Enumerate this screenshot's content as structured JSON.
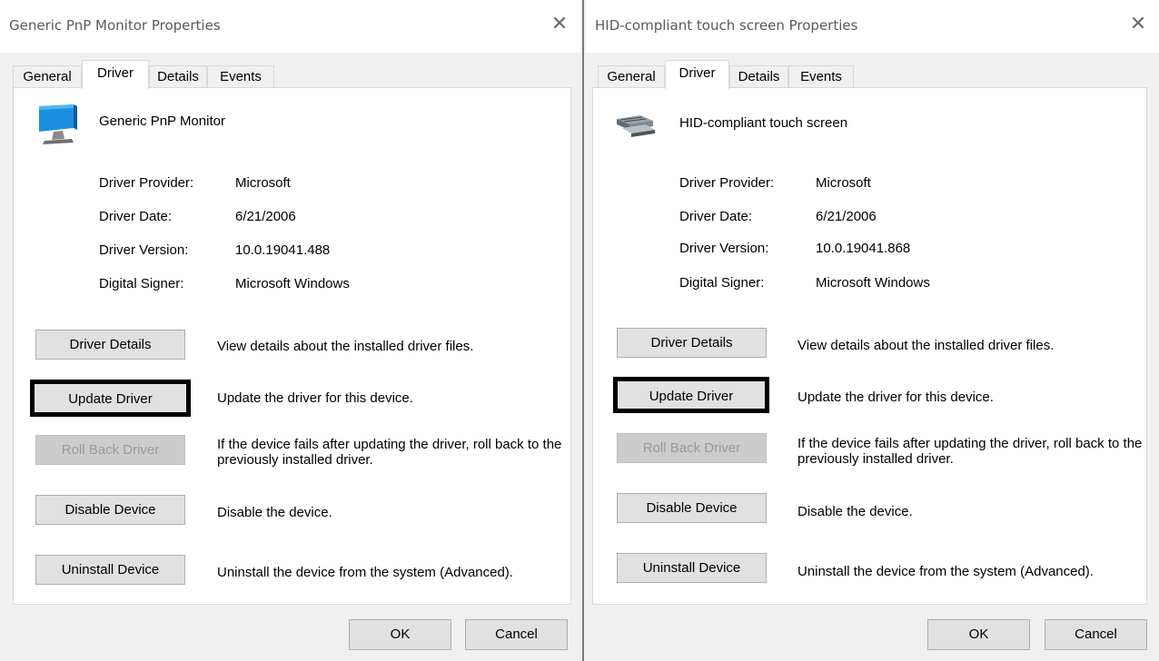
{
  "left_dialog": {
    "title": "Generic PnP Monitor Properties",
    "tabs": [
      "General",
      "Driver",
      "Details",
      "Events"
    ],
    "active_tab": "Driver",
    "device_icon": "monitor-icon",
    "device_name": "Generic PnP Monitor",
    "props": [
      {
        "label": "Driver Provider:",
        "value": "Microsoft"
      },
      {
        "label": "Driver Date:",
        "value": "6/21/2006"
      },
      {
        "label": "Driver Version:",
        "value": "10.0.19041.488"
      },
      {
        "label": "Digital Signer:",
        "value": "Microsoft Windows"
      }
    ],
    "actions": [
      {
        "button": "Driver Details",
        "desc": "View details about the installed driver files."
      },
      {
        "button": "Update Driver",
        "desc": "Update the driver for this device."
      },
      {
        "button": "Roll Back Driver",
        "desc": "If the device fails after updating the driver, roll back to the previously installed driver."
      },
      {
        "button": "Disable Device",
        "desc": "Disable the device."
      },
      {
        "button": "Uninstall Device",
        "desc": "Uninstall the device from the system (Advanced)."
      }
    ],
    "ok_label": "OK",
    "cancel_label": "Cancel"
  },
  "right_dialog": {
    "title": "HID-compliant touch screen Properties",
    "tabs": [
      "General",
      "Driver",
      "Details",
      "Events"
    ],
    "active_tab": "Driver",
    "device_icon": "hid-device-icon",
    "device_name": "HID-compliant touch screen",
    "props": [
      {
        "label": "Driver Provider:",
        "value": "Microsoft"
      },
      {
        "label": "Driver Date:",
        "value": "6/21/2006"
      },
      {
        "label": "Driver Version:",
        "value": "10.0.19041.868"
      },
      {
        "label": "Digital Signer:",
        "value": "Microsoft Windows"
      }
    ],
    "actions": [
      {
        "button": "Driver Details",
        "desc": "View details about the installed driver files."
      },
      {
        "button": "Update Driver",
        "desc": "Update the driver for this device."
      },
      {
        "button": "Roll Back Driver",
        "desc": "If the device fails after updating the driver, roll back to the previously installed driver."
      },
      {
        "button": "Disable Device",
        "desc": "Disable the device."
      },
      {
        "button": "Uninstall Device",
        "desc": "Uninstall the device from the system (Advanced)."
      }
    ],
    "ok_label": "OK",
    "cancel_label": "Cancel"
  }
}
